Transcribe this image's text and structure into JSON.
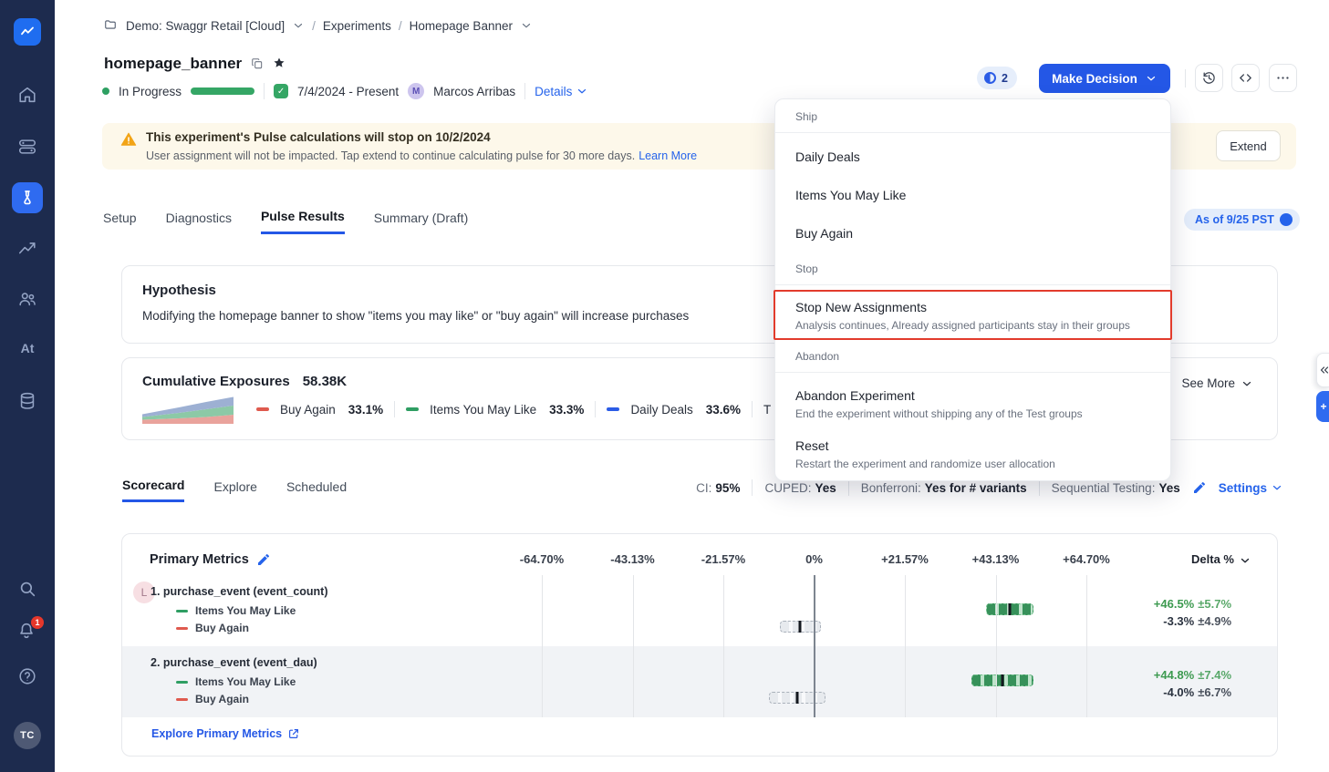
{
  "colors": {
    "accent_blue": "#2457e6",
    "link_blue": "#2563eb",
    "green": "#2f9e63",
    "red": "#df5a4e",
    "warning_bg": "#fdf8ea",
    "annotation_red": "#e23b2c",
    "sidebar_bg": "#1d2b4e"
  },
  "sidebar": {
    "at_label": "At",
    "notification_count": "1",
    "avatar": "TC",
    "active_icon": "experiments"
  },
  "breadcrumb": {
    "project": "Demo: Swaggr Retail [Cloud]",
    "separator": "/",
    "section": "Experiments",
    "page": "Homepage Banner"
  },
  "header": {
    "title": "homepage_banner",
    "pending_badge": "2",
    "make_decision_label": "Make Decision",
    "status_label": "In Progress",
    "date_range": "7/4/2024 - Present",
    "owner_initial": "M",
    "owner_name": "Marcos Arribas",
    "details_label": "Details"
  },
  "warning_banner": {
    "title": "This experiment's Pulse calculations will stop on 10/2/2024",
    "body": "User assignment will not be impacted. Tap extend to continue calculating pulse for 30 more days.",
    "link_label": "Learn More",
    "button_label": "Extend"
  },
  "tabs": {
    "items": [
      "Setup",
      "Diagnostics",
      "Pulse Results",
      "Summary (Draft)"
    ],
    "active": "Pulse Results",
    "as_of_label": "As of 9/25 PST"
  },
  "hypothesis": {
    "title": "Hypothesis",
    "text": "Modifying the homepage banner to show \"items you may like\" or \"buy again\" will increase purchases"
  },
  "exposures": {
    "title": "Cumulative Exposures",
    "total": "58.38K",
    "legend": [
      {
        "label": "Buy Again",
        "value": "33.1%",
        "color": "#df5a4e"
      },
      {
        "label": "Items You May Like",
        "value": "33.3%",
        "color": "#2f9e63"
      },
      {
        "label": "Daily Deals",
        "value": "33.6%",
        "color": "#2b5ce6"
      },
      {
        "label": "T",
        "value": "",
        "color": "#8a94a6"
      }
    ],
    "see_more_label": "See More"
  },
  "decision_menu": {
    "sections": [
      {
        "label": "Ship",
        "items": [
          {
            "title": "Daily Deals",
            "subtitle": ""
          },
          {
            "title": "Items You May Like",
            "subtitle": ""
          },
          {
            "title": "Buy Again",
            "subtitle": ""
          }
        ]
      },
      {
        "label": "Stop",
        "items": [
          {
            "title": "Stop New Assignments",
            "subtitle": "Analysis continues, Already assigned participants stay in their groups"
          }
        ]
      },
      {
        "label": "Abandon",
        "items": [
          {
            "title": "Abandon Experiment",
            "subtitle": "End the experiment without shipping any of the Test groups"
          },
          {
            "title": "Reset",
            "subtitle": "Restart the experiment and randomize user allocation"
          }
        ]
      }
    ]
  },
  "scorecard": {
    "tabs": [
      "Scorecard",
      "Explore",
      "Scheduled"
    ],
    "active": "Scorecard",
    "settings": [
      {
        "label": "CI:",
        "value": "95%"
      },
      {
        "label": "CUPED:",
        "value": "Yes"
      },
      {
        "label": "Bonferroni:",
        "value": "Yes for # variants"
      },
      {
        "label": "Sequential Testing:",
        "value": "Yes"
      }
    ],
    "settings_link": "Settings"
  },
  "primary_metrics": {
    "title": "Primary Metrics",
    "delta_header": "Delta %",
    "axis_ticks": [
      "-64.70%",
      "-43.13%",
      "-21.57%",
      "0%",
      "+21.57%",
      "+43.13%",
      "+64.70%"
    ],
    "axis_range": [
      -64.7,
      64.7
    ],
    "rows": [
      {
        "avatar": "L",
        "name": "1. purchase_event (event_count)",
        "series": [
          {
            "label": "Items You May Like",
            "color": "#2f9e63",
            "delta": "+46.5%",
            "moe": "±5.7%",
            "center": 46.5,
            "spread": 5.7
          },
          {
            "label": "Buy Again",
            "color": "#df5a4e",
            "delta": "-3.3%",
            "moe": "±4.9%",
            "center": -3.3,
            "spread": 4.9
          }
        ]
      },
      {
        "avatar": "",
        "name": "2. purchase_event (event_dau)",
        "series": [
          {
            "label": "Items You May Like",
            "color": "#2f9e63",
            "delta": "+44.8%",
            "moe": "±7.4%",
            "center": 44.8,
            "spread": 7.4
          },
          {
            "label": "Buy Again",
            "color": "#df5a4e",
            "delta": "-4.0%",
            "moe": "±6.7%",
            "center": -4.0,
            "spread": 6.7
          }
        ]
      }
    ],
    "explore_link": "Explore Primary Metrics"
  }
}
